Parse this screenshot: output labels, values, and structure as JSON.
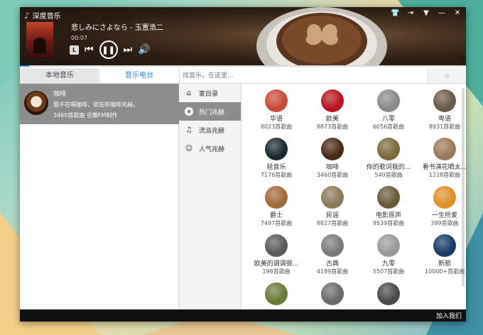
{
  "app": {
    "title": "深度音乐"
  },
  "window_controls": [
    "skin",
    "mini",
    "menu",
    "minimize",
    "close"
  ],
  "player": {
    "song_title": "悲しみにさよなら - 玉置浩二",
    "elapsed": "00:07",
    "mode_label": "L",
    "progress": 0.02
  },
  "tabs": {
    "local": "本地音乐",
    "radio": "音乐电台"
  },
  "search": {
    "placeholder": "找音乐，在这里..."
  },
  "now_playing": {
    "name": "咖啡",
    "desc": "我不在喝咖啡，就在听咖啡兆赫。",
    "count": "3460首歌曲 豆瓣FM制作"
  },
  "categories": [
    {
      "label": "家目录",
      "icon": "home-icon"
    },
    {
      "label": "热门兆赫",
      "icon": "hot-icon"
    },
    {
      "label": "流派兆赫",
      "icon": "music-note-icon"
    },
    {
      "label": "人气兆赫",
      "icon": "smile-icon"
    }
  ],
  "channels": [
    {
      "name": "华语",
      "count": "8023首歌曲",
      "color": "#c94a3a"
    },
    {
      "name": "欧美",
      "count": "8873首歌曲",
      "color": "#b8141f"
    },
    {
      "name": "八零",
      "count": "6056首歌曲",
      "color": "#8a8a8a"
    },
    {
      "name": "粤语",
      "count": "8931首歌曲",
      "color": "#6b5a4a"
    },
    {
      "name": "轻音乐",
      "count": "7176首歌曲",
      "color": "#1a2a2f"
    },
    {
      "name": "咖啡",
      "count": "3460首歌曲",
      "color": "#4a2a16"
    },
    {
      "name": "你的歌词我的...",
      "count": "540首歌曲",
      "color": "#7a6a3a"
    },
    {
      "name": "看书演花晒太...",
      "count": "1228首歌曲",
      "color": "#9a7a5a"
    },
    {
      "name": "爵士",
      "count": "7497首歌曲",
      "color": "#a06a3a"
    },
    {
      "name": "民谣",
      "count": "8827首歌曲",
      "color": "#8a7a5a"
    },
    {
      "name": "电影原声",
      "count": "9539首歌曲",
      "color": "#6a5a3a"
    },
    {
      "name": "一生所爱",
      "count": "399首歌曲",
      "color": "#e0902a"
    },
    {
      "name": "欧美的调调很...",
      "count": "198首歌曲",
      "color": "#5a5a5a"
    },
    {
      "name": "古典",
      "count": "4189首歌曲",
      "color": "#7a7a7a"
    },
    {
      "name": "九零",
      "count": "5507首歌曲",
      "color": "#9a9a9a"
    },
    {
      "name": "新歌",
      "count": "10000+首歌曲",
      "color": "#1a3a6a"
    },
    {
      "name": "",
      "count": "",
      "color": "#6a7a3a"
    },
    {
      "name": "",
      "count": "",
      "color": "#6a6a6a"
    },
    {
      "name": "",
      "count": "",
      "color": "#4a4a4a"
    }
  ],
  "footer": {
    "join": "加入我们"
  }
}
